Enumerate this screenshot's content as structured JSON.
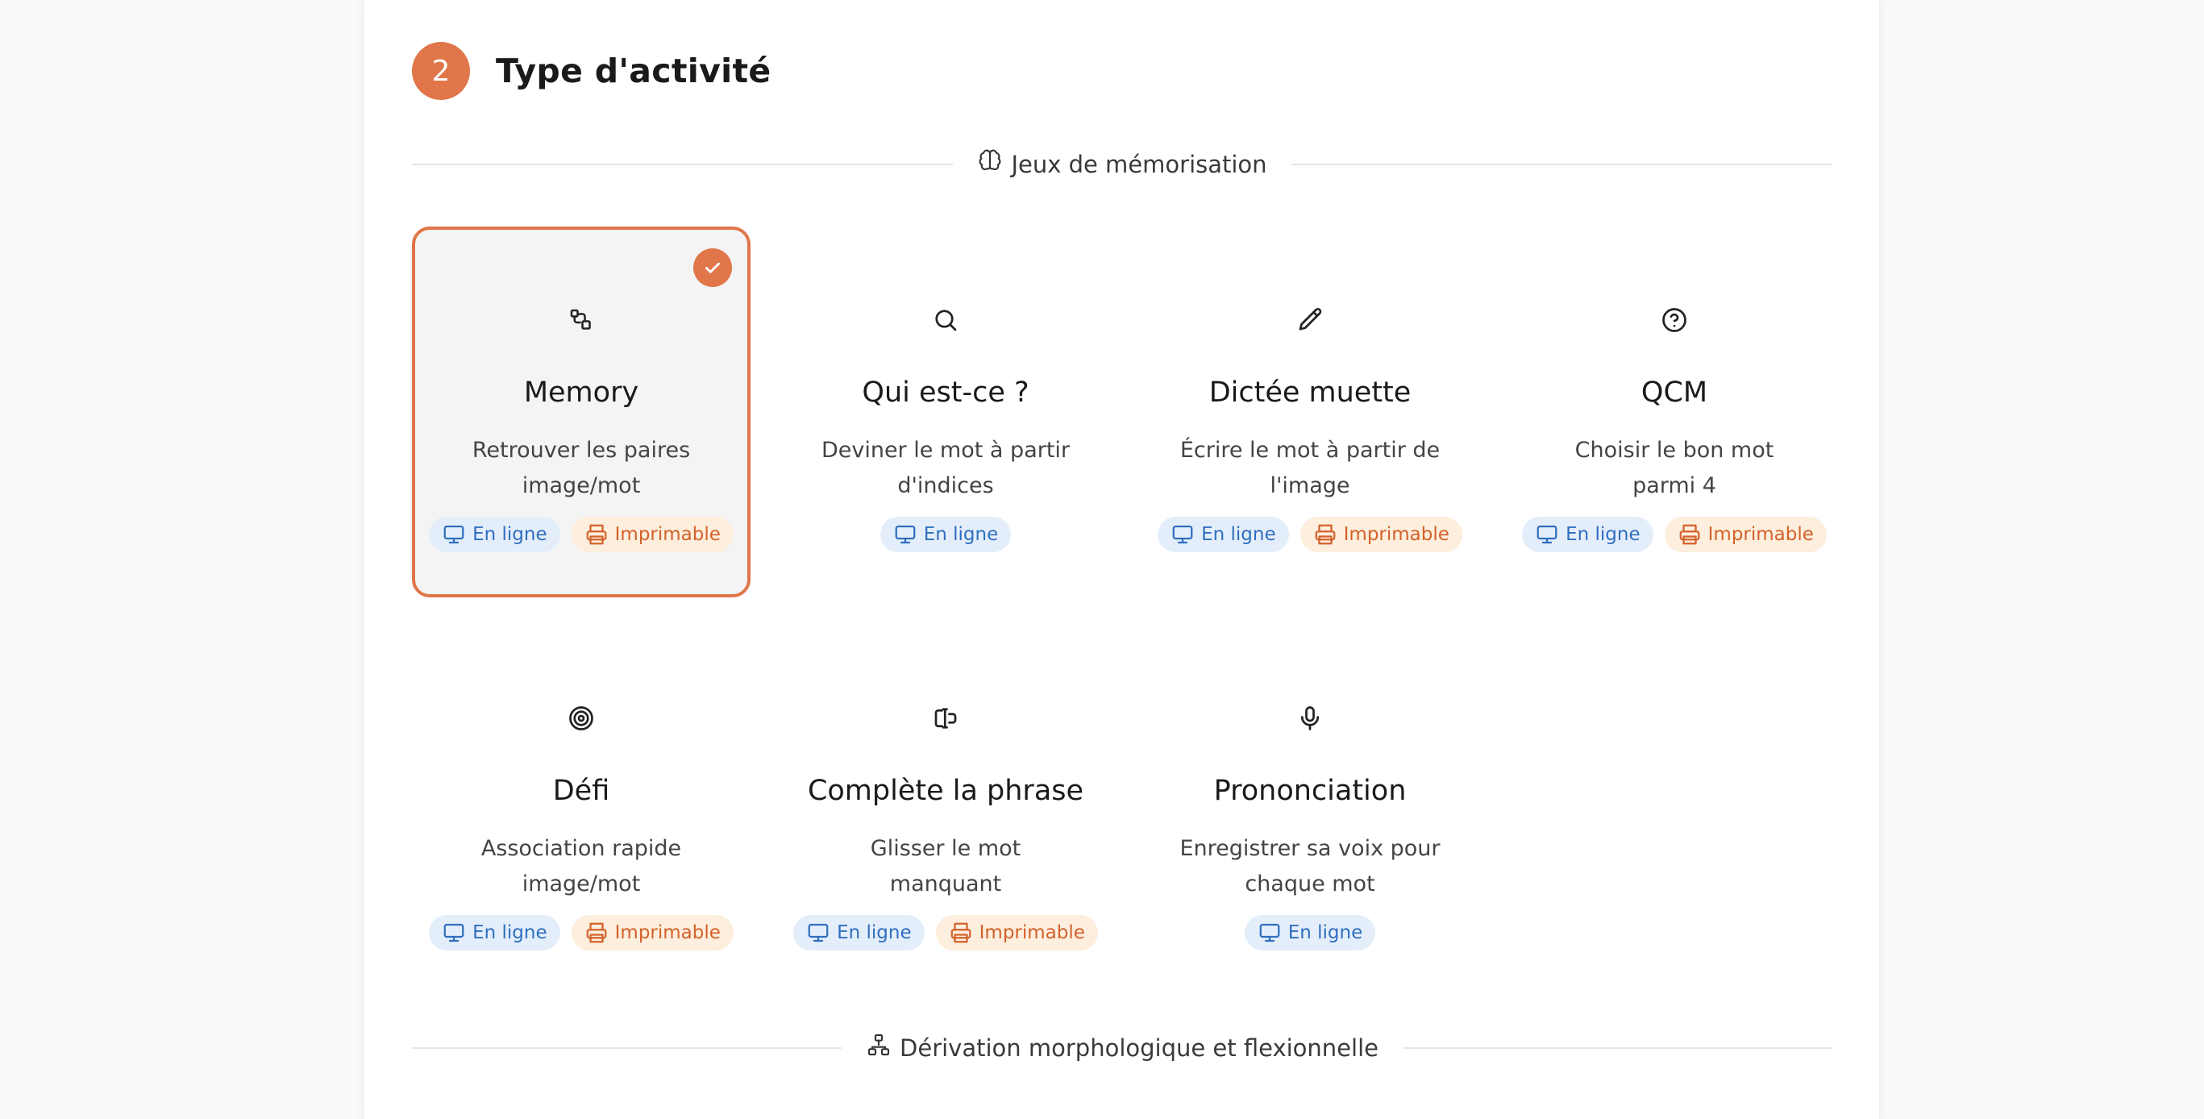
{
  "step": {
    "number": "2",
    "title": "Type d'activité"
  },
  "sections": [
    {
      "label": "Jeux de mémorisation",
      "icon": "brain-icon"
    },
    {
      "label": "Dérivation morphologique et flexionnelle",
      "icon": "network-icon"
    }
  ],
  "badge_labels": {
    "online": "En ligne",
    "print": "Imprimable"
  },
  "activities": [
    {
      "name": "Memory",
      "desc": "Retrouver les paires image/mot",
      "icon": "shapes-icon",
      "online": true,
      "print": true,
      "selected": true
    },
    {
      "name": "Qui est-ce ?",
      "desc": "Deviner le mot à partir d'indices",
      "icon": "search-icon",
      "online": true,
      "print": false,
      "selected": false
    },
    {
      "name": "Dictée muette",
      "desc": "Écrire le mot à partir de l'image",
      "icon": "pencil-icon",
      "online": true,
      "print": true,
      "selected": false
    },
    {
      "name": "QCM",
      "desc": "Choisir le bon mot parmi 4",
      "icon": "help-circle-icon",
      "online": true,
      "print": true,
      "selected": false
    },
    {
      "name": "Défi",
      "desc": "Association rapide image/mot",
      "icon": "target-icon",
      "online": true,
      "print": true,
      "selected": false
    },
    {
      "name": "Complète la phrase",
      "desc": "Glisser le mot manquant",
      "icon": "text-cursor-input-icon",
      "online": true,
      "print": true,
      "selected": false
    },
    {
      "name": "Prononciation",
      "desc": "Enregistrer sa voix pour chaque mot",
      "icon": "microphone-icon",
      "online": true,
      "print": false,
      "selected": false
    }
  ],
  "colors": {
    "accent": "#e07649",
    "online_bg": "#e4eefb",
    "online_fg": "#2f6fbf",
    "print_bg": "#fdeedd",
    "print_fg": "#d3622b"
  }
}
